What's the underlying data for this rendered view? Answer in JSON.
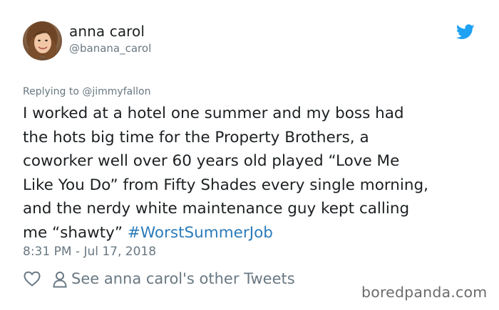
{
  "author": {
    "display_name": "anna carol",
    "handle": "@banana_carol"
  },
  "reply": {
    "text": "Replying to @jimmyfallon"
  },
  "tweet": {
    "lines": [
      "I worked at a hotel one summer and my boss had",
      "the hots big time for the Property Brothers, a",
      "coworker well over 60 years old played “Love Me",
      "Like You Do” from Fifty Shades every single morning,",
      "and the nerdy white maintenance guy kept calling",
      "me “shawty” "
    ],
    "hashtag": "#WorstSummerJob"
  },
  "timestamp": "8:31 PM - Jul 17, 2018",
  "actions": {
    "like_icon": "heart-icon",
    "profile_icon": "person-icon",
    "other_tweets_label": "See anna carol's other Tweets"
  },
  "brand": {
    "twitter_icon": "twitter-bird-icon",
    "twitter_color": "#1da1f2",
    "hashtag_color": "#2b7bb9",
    "secondary_text_color": "#697882",
    "watermark": "boredpanda.com"
  }
}
